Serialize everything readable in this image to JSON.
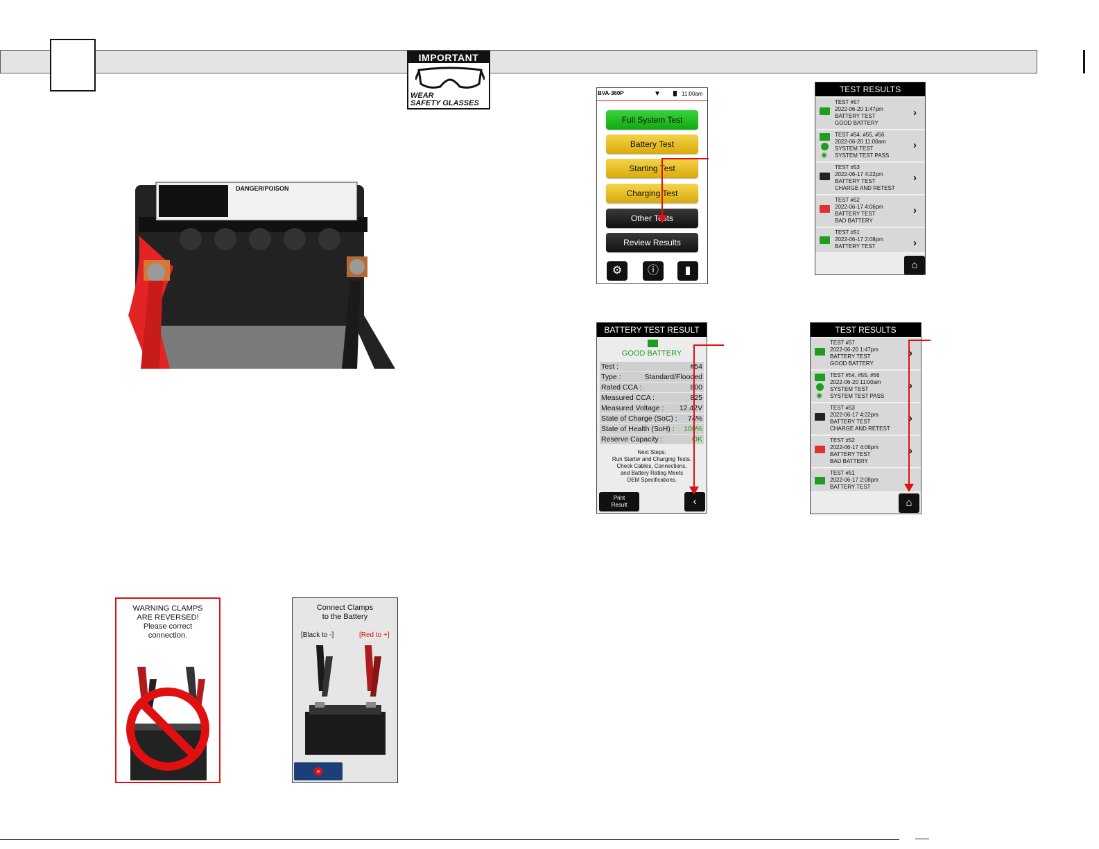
{
  "badge": {
    "top": "IMPORTANT",
    "wear": "WEAR",
    "glasses": "SAFETY GLASSES"
  },
  "photo": {
    "label_text": "DANGER/POISON"
  },
  "main_menu": {
    "model": "BVA-360P",
    "time": "11:00am",
    "buttons": [
      "Full System Test",
      "Battery Test",
      "Starting Test",
      "Charging Test",
      "Other Tests",
      "Review Results"
    ],
    "icons": [
      "gear-icon",
      "info-icon",
      "flashlight-icon"
    ]
  },
  "test_results_1": {
    "title": "TEST RESULTS",
    "items": [
      {
        "lines": [
          "TEST #57",
          "2022-06-20  1:47pm",
          "BATTERY TEST",
          "GOOD BATTERY"
        ],
        "color": "#1f9d1f"
      },
      {
        "lines": [
          "TEST #54, #55, #56",
          "2022-06-20 11:00am",
          "SYSTEM TEST",
          "SYSTEM TEST PASS"
        ],
        "color": "#1f9d1f"
      },
      {
        "lines": [
          "TEST #53",
          "2022-06-17  4:22pm",
          "BATTERY TEST",
          "CHARGE AND RETEST"
        ],
        "color": "#222222"
      },
      {
        "lines": [
          "TEST #52",
          "2022-06-17  4:06pm",
          "BATTERY TEST",
          "BAD BATTERY"
        ],
        "color": "#e03030"
      },
      {
        "lines": [
          "TEST #51",
          "2022-06-17  2:08pm",
          "BATTERY TEST",
          ""
        ],
        "color": "#1f9d1f"
      }
    ]
  },
  "battery_result": {
    "title": "BATTERY TEST RESULT",
    "status": "GOOD BATTERY",
    "rows": [
      {
        "label": "Test :",
        "value": "#54"
      },
      {
        "label": "Type :",
        "value": "Standard/Flooded"
      },
      {
        "label": "Rated CCA :",
        "value": "800"
      },
      {
        "label": "Measured CCA :",
        "value": "825"
      },
      {
        "label": "Measured Voltage :",
        "value": "12.42V"
      },
      {
        "label": "State of Charge (SoC) :",
        "value": "74%"
      },
      {
        "label": "State of Health (SoH) :",
        "value": "100%"
      },
      {
        "label": "Reserve Capacity  :",
        "value": "OK"
      }
    ],
    "next_steps": [
      "Next Steps:",
      "Run Starter and Charging Tests.",
      "Check Cables, Connections,",
      "and Battery Rating Meets",
      "OEM Specifications."
    ],
    "print_label": [
      "Print",
      "Result"
    ]
  },
  "warning": {
    "lines": [
      "WARNING CLAMPS",
      "ARE REVERSED!",
      "Please correct",
      "connection."
    ]
  },
  "connect": {
    "lines": [
      "Connect Clamps",
      "to the Battery"
    ],
    "black": "[Black to -]",
    "red": "[Red to +]"
  }
}
